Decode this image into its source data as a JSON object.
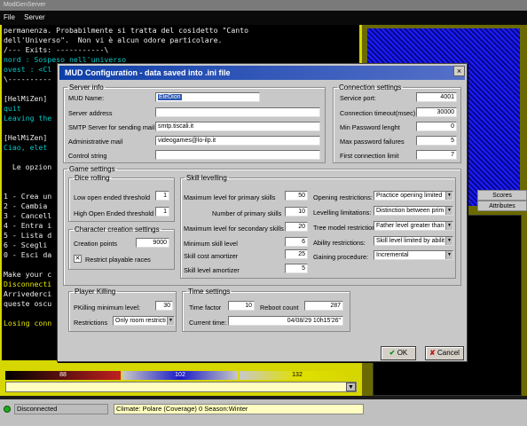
{
  "window": {
    "title": "ModGenServer"
  },
  "menu": {
    "items": [
      "File",
      "Server"
    ]
  },
  "console": {
    "lines": [
      {
        "text": "permanenza. Probabilmente si tratta del cosidetto \"Canto",
        "color": "white"
      },
      {
        "text": "dell'Universo\".  Non vi è alcun odore particolare.",
        "color": "white"
      },
      {
        "text": "/--- Exits: -----------\\",
        "color": "white"
      },
      {
        "text": "nord : Sospeso nell'universo",
        "color": "cyan"
      },
      {
        "text": "ovest : <Cl",
        "color": "cyan"
      },
      {
        "text": "\\----------",
        "color": "white"
      },
      {
        "text": "",
        "color": "white"
      },
      {
        "text": "[HelMiZen]",
        "color": "white"
      },
      {
        "text": "quit",
        "color": "cyan"
      },
      {
        "text": "Leaving the",
        "color": "cyan"
      },
      {
        "text": "",
        "color": "white"
      },
      {
        "text": "[HelMiZen]",
        "color": "white"
      },
      {
        "text": "Ciao, elet",
        "color": "cyan"
      },
      {
        "text": "",
        "color": "white"
      },
      {
        "text": "  Le opzion",
        "color": "white"
      },
      {
        "text": "",
        "color": "white"
      },
      {
        "text": "",
        "color": "white"
      },
      {
        "text": "1 - Crea un",
        "color": "white"
      },
      {
        "text": "2 - Cambia",
        "color": "white"
      },
      {
        "text": "3 - Cancell",
        "color": "white"
      },
      {
        "text": "4 - Entra i",
        "color": "white"
      },
      {
        "text": "5 - Lista d",
        "color": "white"
      },
      {
        "text": "6 - Scegli",
        "color": "white"
      },
      {
        "text": "0 - Esci da",
        "color": "white"
      },
      {
        "text": "",
        "color": "white"
      },
      {
        "text": "Make your c",
        "color": "white"
      },
      {
        "text": "Disconnecti",
        "color": "yellow"
      },
      {
        "text": "Arrivederci",
        "color": "white"
      },
      {
        "text": "queste oscu",
        "color": "white"
      },
      {
        "text": "",
        "color": "white"
      },
      {
        "text": "Losing conn",
        "color": "yellow"
      }
    ]
  },
  "gauges": [
    {
      "value": "88",
      "color": "#c02020"
    },
    {
      "value": "102",
      "color": "#1a1ac8"
    },
    {
      "value": "132",
      "color": "#d6d600"
    }
  ],
  "right_tabs": [
    "Scores",
    "Attributes"
  ],
  "status": {
    "connection": "Disconnected",
    "climate": "Climate: Polare (Coverage) 0 Season:Winter"
  },
  "dialog": {
    "title": "MUD Configuration - data saved into .ini file",
    "close": "×",
    "server_info": {
      "legend": "Server info",
      "mud_name_label": "MUD Name:",
      "mud_name": "EleDion",
      "server_address_label": "Server address",
      "server_address": "",
      "smtp_label": "SMTP Server for sending mail",
      "smtp": "smtp.tiscali.it",
      "admin_mail_label": "Administrative mail",
      "admin_mail": "videogames@lo-ilp.it",
      "control_string_label": "Control string",
      "control_string": ""
    },
    "connection": {
      "legend": "Connection settings",
      "service_port_label": "Service port:",
      "service_port": "4001",
      "timeout_label": "Connection timeout(msec)",
      "timeout": "30000",
      "min_pwd_label": "Min Password lenght",
      "min_pwd": "0",
      "max_pwd_fail_label": "Max password failures",
      "max_pwd_fail": "5",
      "first_conn_label": "First connection limit",
      "first_conn": "7"
    },
    "game": {
      "legend": "Game settings",
      "dice": {
        "legend": "Dice rolling",
        "low_label": "Low open ended threshold",
        "low": "1",
        "high_label": "High Open Ended threshold",
        "high": "1"
      },
      "creation": {
        "legend": "Character creation settings",
        "points_label": "Creation points",
        "points": "9000",
        "restrict_label": "Restrict playable races",
        "restrict_checked": "✕"
      },
      "skill": {
        "legend": "Skill levelling",
        "max_primary_label": "Maximum level for primary skills",
        "max_primary": "50",
        "num_primary_label": "Number of primary skills",
        "num_primary": "10",
        "max_secondary_label": "Maximum level for secondary skills",
        "max_secondary": "20",
        "min_level_label": "Minimum skill level",
        "min_level": "6",
        "cost_label": "Skill cost amortizer",
        "cost": "25",
        "level_label": "Skill level amortizer",
        "level": "5",
        "opening_label": "Opening restrictions:",
        "opening": "Practice opening limited",
        "levelling_label": "Levelling limitations:",
        "levelling": "Distinction between prim",
        "tree_label": "Tree model restriction",
        "tree": "Father level greater than",
        "ability_label": "Ability restrictions:",
        "ability": "Skill level limited by abilit",
        "gaining_label": "Gaining procedure:",
        "gaining": "Incremental"
      }
    },
    "pk": {
      "legend": "Player Killing",
      "min_level_label": "PKilling minimum level:",
      "min_level": "30",
      "restrictions_label": "Restrictions",
      "restrictions": "Only room restricti"
    },
    "time": {
      "legend": "Time settings",
      "factor_label": "Time factor",
      "factor": "10",
      "reboot_label": "Reboot count",
      "reboot": "287",
      "current_label": "Current time:",
      "current": "04/08/29  10h15'26\""
    },
    "buttons": {
      "ok": "OK",
      "ok_icon": "✔",
      "cancel": "Cancel",
      "cancel_icon": "✘"
    }
  }
}
